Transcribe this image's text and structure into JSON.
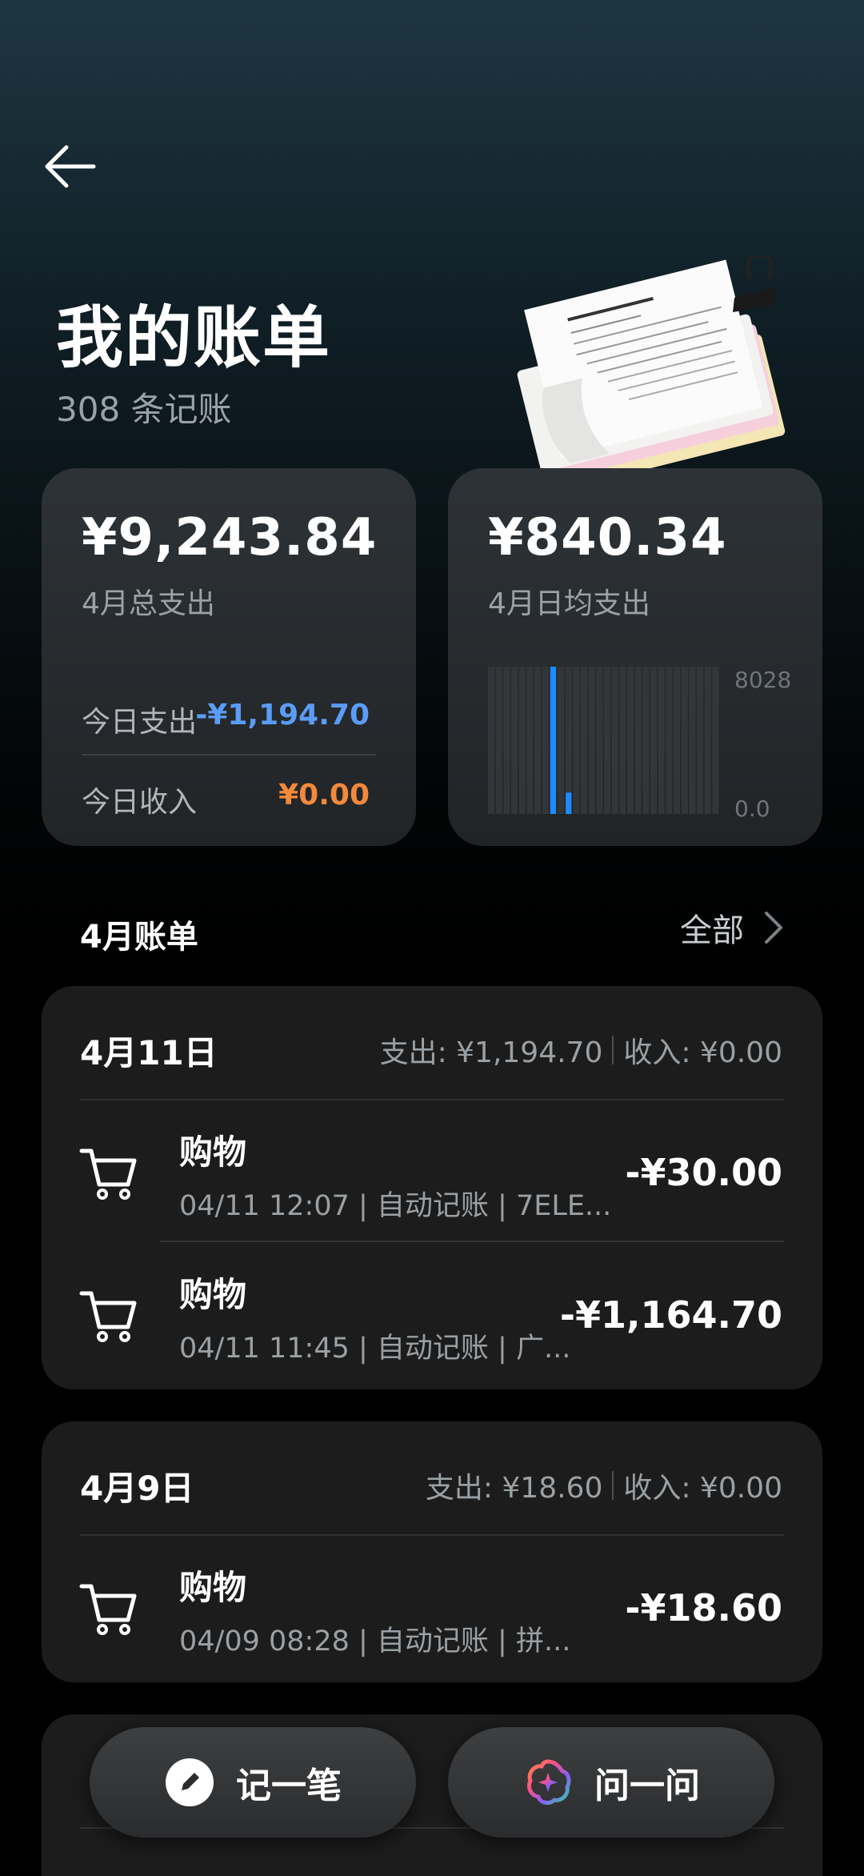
{
  "header": {
    "title": "我的账单",
    "record_count": "308 条记账"
  },
  "summary": {
    "total": {
      "amount": "¥9,243.84",
      "label": "4月总支出",
      "today_expense_label": "今日支出",
      "today_expense_value": "-¥1,194.70",
      "today_income_label": "今日收入",
      "today_income_value": "¥0.00"
    },
    "daily": {
      "amount": "¥840.34",
      "label": "4月日均支出"
    }
  },
  "chart_data": {
    "type": "bar",
    "values": [
      0,
      0,
      0,
      0,
      0,
      0,
      0,
      0,
      8028,
      0,
      1165,
      0,
      0,
      0,
      0,
      0,
      0,
      0,
      0,
      0,
      0,
      0,
      0,
      0,
      0,
      0,
      0,
      0,
      0,
      0
    ],
    "highlight_color": "#1a8cff",
    "ylim": [
      0,
      8028
    ],
    "y_max_label": "8028",
    "y_min_label": "0.0"
  },
  "section": {
    "title": "4月账单",
    "all_label": "全部"
  },
  "groups": [
    {
      "date": "4月11日",
      "expense": "支出: ¥1,194.70",
      "income": "收入: ¥0.00",
      "items": [
        {
          "title": "购物",
          "meta": "04/11 12:07 | 自动记账 | 7ELE...",
          "amount": "-¥30.00",
          "icon": "shopping-cart-icon"
        },
        {
          "title": "购物",
          "meta": "04/11 11:45 | 自动记账 | 广...",
          "amount": "-¥1,164.70",
          "icon": "shopping-cart-icon"
        }
      ]
    },
    {
      "date": "4月9日",
      "expense": "支出: ¥18.60",
      "income": "收入: ¥0.00",
      "items": [
        {
          "title": "购物",
          "meta": "04/09 08:28 | 自动记账 | 拼...",
          "amount": "-¥18.60",
          "icon": "shopping-cart-icon"
        }
      ]
    }
  ],
  "actions": {
    "record_label": "记一笔",
    "ask_label": "问一问"
  },
  "colors": {
    "expense_blue": "#5b9cf6",
    "income_orange": "#f3893a",
    "accent_blue": "#1a8cff"
  }
}
